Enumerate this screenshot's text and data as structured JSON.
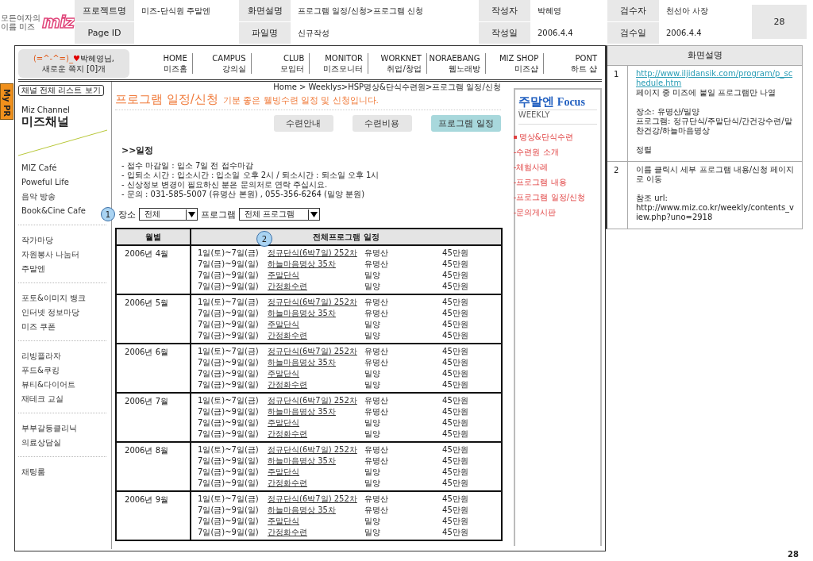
{
  "doc_header": {
    "logo": {
      "tagline_1": "모든여자의",
      "tagline_2": "이름 미즈",
      "mark": "miz"
    },
    "rows": [
      [
        {
          "label": "프로젝트명",
          "value": "미즈-단식원 주말엔"
        },
        {
          "label": "화면설명",
          "value": "프로그램 일정/신청>프로그램 신청"
        },
        {
          "label": "작성자",
          "value": "박혜영"
        },
        {
          "label": "검수자",
          "value": "천선아 사장"
        }
      ],
      [
        {
          "label": "Page ID"
        },
        {
          "label": "파일명",
          "value": "신규작성"
        },
        {
          "label": "작성일",
          "value": "2006.4.4"
        },
        {
          "label": "검수일",
          "value": "2006.4.4"
        }
      ]
    ],
    "page_number": "28"
  },
  "my_pr_tab": "My PR",
  "user_box": {
    "emoticon": "(=^-^=)_",
    "heart": "♥",
    "name": "박혜영님,",
    "message": "새로운 쪽지 [0]개"
  },
  "nav": [
    {
      "en": "HOME",
      "ko": "미즈홈"
    },
    {
      "en": "CAMPUS",
      "ko": "강의실"
    },
    {
      "en": "CLUB",
      "ko": "모임터"
    },
    {
      "en": "MONITOR",
      "ko": "미즈모니터"
    },
    {
      "en": "WORKNET",
      "ko": "취업/창업"
    },
    {
      "en": "NORAEBANG",
      "ko": "웹노래방"
    },
    {
      "en": "MIZ SHOP",
      "ko": "미즈샵"
    },
    {
      "en": "PONT",
      "ko": "하트 샵"
    }
  ],
  "sidebar": {
    "list_button": "채널 전체 리스트 보기",
    "channel_en": "Miz Channel",
    "channel_ko": "미즈채널",
    "groups": [
      [
        "MIZ Café",
        "Poweful Life",
        "음악 방송",
        "Book&Cine Cafe"
      ],
      [
        "작가마당",
        "자원봉사 나눔터",
        "주말엔"
      ],
      [
        "포토&이미지 뱅크",
        "인터넷 정보마당",
        "미즈 쿠폰"
      ],
      [
        "리빙플라자",
        "푸드&쿠킹",
        "뷰티&다이어트",
        "재테크 교실"
      ],
      [
        "부부갈등클리닉",
        "의료상담실"
      ],
      [
        "채팅룸"
      ]
    ]
  },
  "breadcrumb": "Home > Weeklys>HSP명상&단식수련원>프로그램 일정/신청",
  "page_title": "프로그램 일정/신청",
  "page_subtitle": "기분 좋은 웰빙수련 일정 및 신청입니다.",
  "tabs": [
    {
      "label": "수련안내",
      "selected": false
    },
    {
      "label": "수련비용",
      "selected": false
    },
    {
      "label": "프로그램 일정",
      "selected": true
    }
  ],
  "section_heading": ">>일정",
  "notes": [
    "- 접수 마감일 : 입소 7일 전 접수마감",
    "- 입퇴소 시간 : 입소시간 : 입소일 오후 2시 / 퇴소시간 : 퇴소일 오후 1시",
    "- 신상정보 변경이 필요하신 분은 문의처로 연락 주십시요.",
    "- 문의 : 031-585-5007 (유명산 본원) , 055-356-6264 (밀양 분원)"
  ],
  "filters": {
    "marker": "1",
    "place_label": "장소",
    "place_value": "전체",
    "program_label": "프로그램",
    "program_value": "전체 프로그램"
  },
  "table": {
    "marker": "2",
    "columns": [
      "월별",
      "전체프로그램 일정"
    ],
    "months": [
      {
        "month": "2006년 4월",
        "sessions": [
          {
            "date": "1일(토)~7일(금)",
            "name": "정규단식(6박7일) 252차",
            "place": "유명산",
            "price": "45만원"
          },
          {
            "date": "7일(금)~9일(일)",
            "name": "하늘마음명상 35차",
            "place": "유명산",
            "price": "45만원"
          },
          {
            "date": "7일(금)~9일(일)",
            "name": "주말단식",
            "place": "밀양",
            "price": "45만원"
          },
          {
            "date": "7일(금)~9일(일)",
            "name": "간정화수련",
            "place": "밀양",
            "price": "45만원"
          }
        ]
      },
      {
        "month": "2006년 5월",
        "sessions": [
          {
            "date": "1일(토)~7일(금)",
            "name": "정규단식(6박7일) 252차",
            "place": "유명산",
            "price": "45만원"
          },
          {
            "date": "7일(금)~9일(일)",
            "name": "하늘마음명상 35차",
            "place": "유명산",
            "price": "45만원"
          },
          {
            "date": "7일(금)~9일(일)",
            "name": "주말단식",
            "place": "밀양",
            "price": "45만원"
          },
          {
            "date": "7일(금)~9일(일)",
            "name": "간정화수련",
            "place": "밀양",
            "price": "45만원"
          }
        ]
      },
      {
        "month": "2006년 6월",
        "sessions": [
          {
            "date": "1일(토)~7일(금)",
            "name": "정규단식(6박7일) 252차",
            "place": "유명산",
            "price": "45만원"
          },
          {
            "date": "7일(금)~9일(일)",
            "name": "하늘마음명상 35차",
            "place": "유명산",
            "price": "45만원"
          },
          {
            "date": "7일(금)~9일(일)",
            "name": "주말단식",
            "place": "밀양",
            "price": "45만원"
          },
          {
            "date": "7일(금)~9일(일)",
            "name": "간정화수련",
            "place": "밀양",
            "price": "45만원"
          }
        ]
      },
      {
        "month": "2006년 7월",
        "sessions": [
          {
            "date": "1일(토)~7일(금)",
            "name": "정규단식(6박7일) 252차",
            "place": "유명산",
            "price": "45만원"
          },
          {
            "date": "7일(금)~9일(일)",
            "name": "하늘마음명상 35차",
            "place": "유명산",
            "price": "45만원"
          },
          {
            "date": "7일(금)~9일(일)",
            "name": "주말단식",
            "place": "밀양",
            "price": "45만원"
          },
          {
            "date": "7일(금)~9일(일)",
            "name": "간정화수련",
            "place": "밀양",
            "price": "45만원"
          }
        ]
      },
      {
        "month": "2006년 8월",
        "sessions": [
          {
            "date": "1일(토)~7일(금)",
            "name": "정규단식(6박7일) 252차",
            "place": "유명산",
            "price": "45만원"
          },
          {
            "date": "7일(금)~9일(일)",
            "name": "하늘마음명상 35차",
            "place": "유명산",
            "price": "45만원"
          },
          {
            "date": "7일(금)~9일(일)",
            "name": "주말단식",
            "place": "밀양",
            "price": "45만원"
          },
          {
            "date": "7일(금)~9일(일)",
            "name": "간정화수련",
            "place": "밀양",
            "price": "45만원"
          }
        ]
      },
      {
        "month": "2006년 9월",
        "sessions": [
          {
            "date": "1일(토)~7일(금)",
            "name": "정규단식(6박7일) 252차",
            "place": "유명산",
            "price": "45만원"
          },
          {
            "date": "7일(금)~9일(일)",
            "name": "하늘마음명상 35차",
            "place": "유명산",
            "price": "45만원"
          },
          {
            "date": "7일(금)~9일(일)",
            "name": "주말단식",
            "place": "밀양",
            "price": "45만원"
          },
          {
            "date": "7일(금)~9일(일)",
            "name": "간정화수련",
            "place": "밀양",
            "price": "45만원"
          }
        ]
      }
    ]
  },
  "focus": {
    "title_ko": "주말엔",
    "title_en": "Focus",
    "subtitle": "WEEKLY",
    "items": [
      {
        "label": "명상&단식수련",
        "bullet": true
      },
      {
        "label": "-수련원 소개",
        "bullet": false
      },
      {
        "label": "-체험사례",
        "bullet": false
      },
      {
        "label": "-프로그램 내용",
        "bullet": false
      },
      {
        "label": "-프로그램 일정/신청",
        "bullet": false
      },
      {
        "label": "-문의게시판",
        "bullet": false
      }
    ]
  },
  "description": {
    "title": "화면설명",
    "rows": [
      {
        "number": "1",
        "lines": [
          {
            "kind": "link",
            "text": "http://www.iljidansik.com/program/p_schedule.htm"
          },
          {
            "kind": "text",
            "text": "페이지 중 미즈에 붙일 프로그램만 나열"
          },
          {
            "kind": "gap"
          },
          {
            "kind": "text",
            "text": "장소: 유명산/밀양"
          },
          {
            "kind": "text",
            "text": "프로그램: 정규단식/주말단식/간건강수련/말찬건강/하늘마음명상"
          },
          {
            "kind": "gap"
          },
          {
            "kind": "text",
            "text": "정렬"
          }
        ]
      },
      {
        "number": "2",
        "lines": [
          {
            "kind": "text",
            "text": "이름 클릭시 세부 프로그램 내용/신청 페이지로 이동"
          },
          {
            "kind": "gap"
          },
          {
            "kind": "text",
            "text": "참조 url:"
          },
          {
            "kind": "text",
            "text": "http://www.miz.co.kr/weekly/contents_view.php?uno=2918"
          }
        ]
      }
    ]
  },
  "footer_page_number": "28"
}
